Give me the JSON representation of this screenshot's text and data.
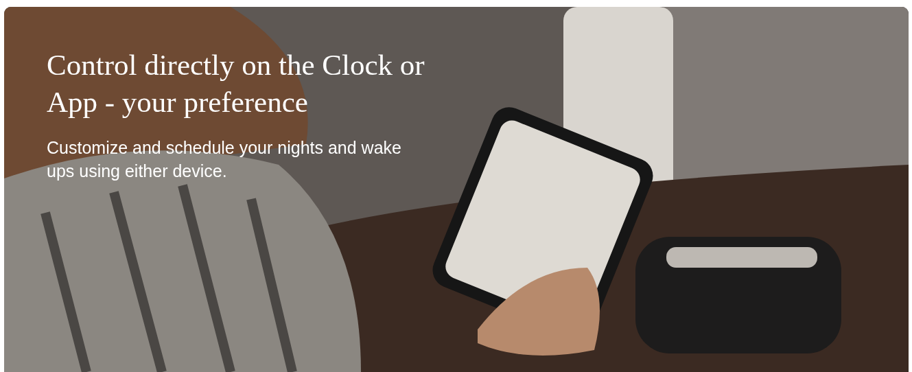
{
  "hero": {
    "headline": "Control directly on the Clock or App - your preference",
    "subtitle": "Customize and schedule your nights and wake ups using either device."
  }
}
